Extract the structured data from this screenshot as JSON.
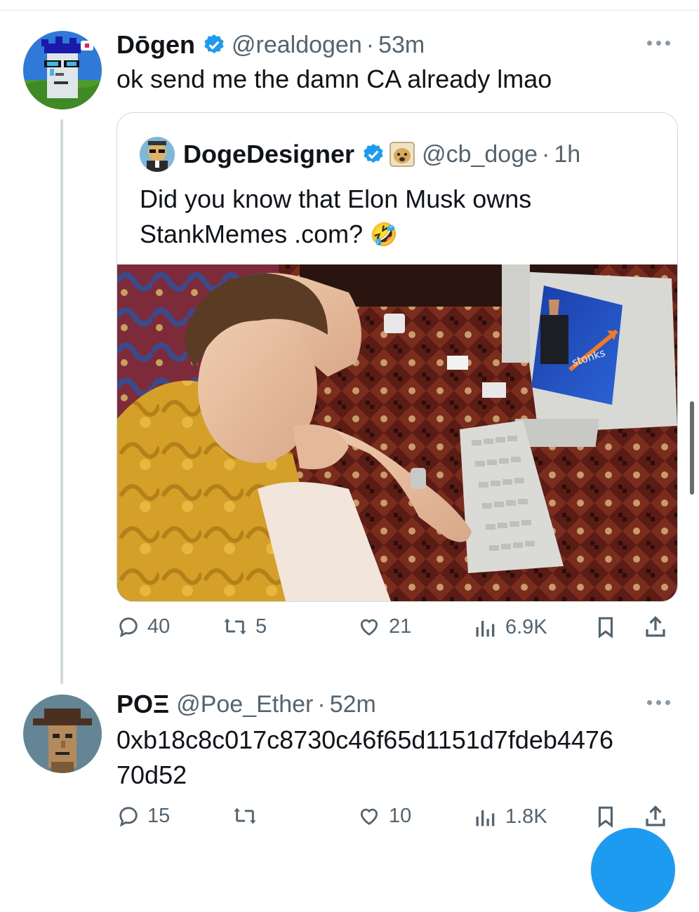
{
  "tweet1": {
    "name": "Dōgen",
    "handle": "@realdogen",
    "time": "53m",
    "text": "ok send me the damn CA already lmao",
    "quote": {
      "name": "DogeDesigner",
      "handle": "@cb_doge",
      "time": "1h",
      "text_line1": "Did you know that Elon Musk owns",
      "text_line2": "StankMemes .com?",
      "emoji": "🤣",
      "media_text": "stonks"
    },
    "stats": {
      "replies": "40",
      "reposts": "5",
      "likes": "21",
      "views": "6.9K"
    }
  },
  "tweet2": {
    "name": "POΞ",
    "handle": "@Poe_Ether",
    "time": "52m",
    "text_line1": "0xb18c8c017c8730c46f65d1151d7fdeb4476",
    "text_line2": "70d52",
    "stats": {
      "replies": "15",
      "reposts": "",
      "likes": "10",
      "views": "1.8K"
    }
  },
  "separator": "·",
  "colors": {
    "accent": "#1d9bf0",
    "secondary_text": "#536471",
    "border": "#cfd9de"
  },
  "icons": [
    "verified-badge-icon",
    "reply-icon",
    "repost-icon",
    "like-icon",
    "views-icon",
    "bookmark-icon",
    "share-icon",
    "more-icon"
  ]
}
